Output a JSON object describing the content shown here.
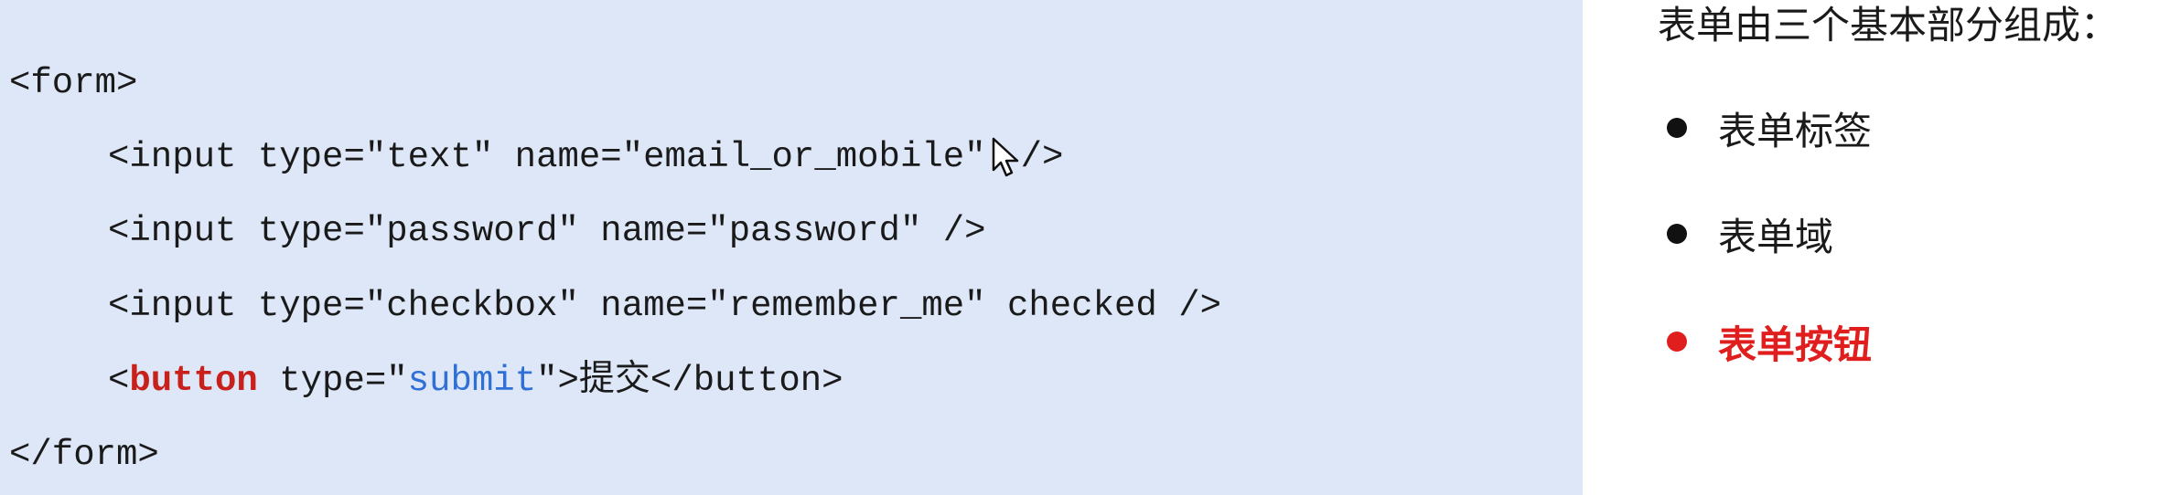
{
  "code": {
    "line1": "<form>",
    "line2_text": "<input type=\"text\" name=\"email_or_mobile\"",
    "line2_end": "/>",
    "line3": "<input type=\"password\" name=\"password\" />",
    "line4": "<input type=\"checkbox\" name=\"remember_me\" checked />",
    "line5_open": "<",
    "line5_keyword": "button",
    "line5_attr": " type=\"",
    "line5_value": "submit",
    "line5_rest": "\">提交</button>",
    "line6": "</form>"
  },
  "notes": {
    "title": "表单由三个基本部分组成：",
    "items": [
      {
        "label": "表单标签"
      },
      {
        "label": "表单域"
      },
      {
        "label": "表单按钮"
      }
    ]
  },
  "icons": {
    "cursor": "mouse-pointer-icon"
  },
  "colors": {
    "code_background": "#dde7f7",
    "keyword": "#c8201b",
    "string_value": "#2f6fd6",
    "highlight": "#e01e1e"
  }
}
